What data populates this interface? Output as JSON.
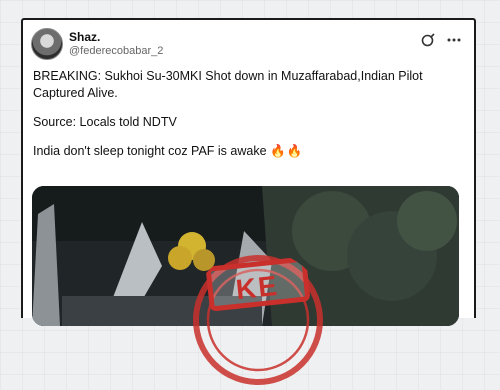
{
  "post": {
    "author_name": "Shaz.",
    "author_handle": "@federecobabar_2",
    "body_line1": "BREAKING: Sukhoi Su-30MKI Shot down in Muzaffarabad,Indian Pilot Captured Alive.",
    "body_line2": "Source: Locals told NDTV",
    "body_line3": "India don't sleep tonight coz PAF is awake",
    "emoji": "🔥🔥"
  },
  "icons": {
    "header_right": [
      "grok-icon",
      "more-options-icon"
    ]
  },
  "stamp": {
    "label": "KE",
    "color": "#c9302c"
  }
}
